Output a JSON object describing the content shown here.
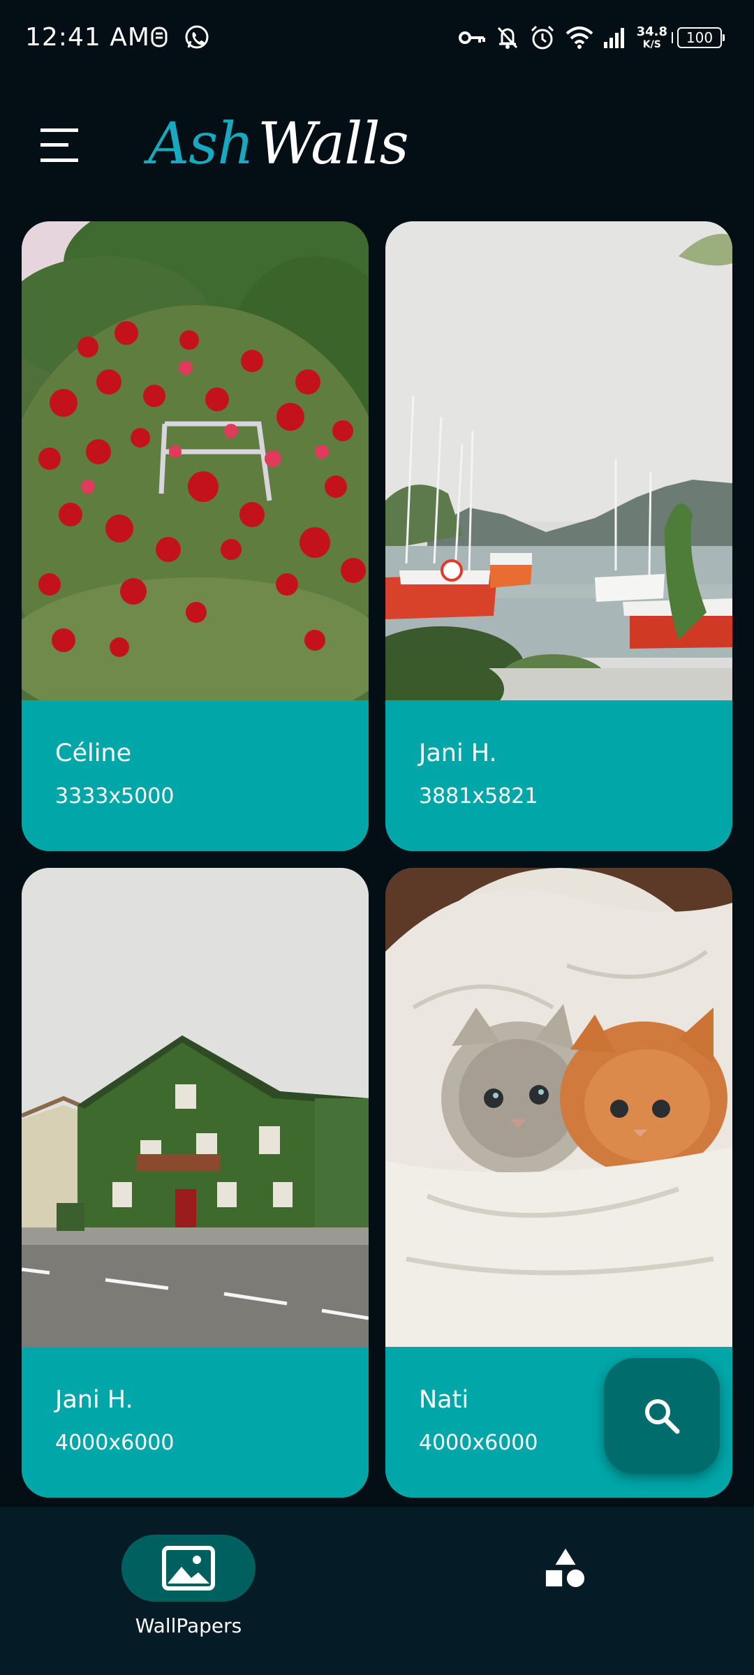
{
  "status_bar": {
    "time": "12:41 AM",
    "left_icons": [
      "notification-app-icon",
      "whatsapp-icon"
    ],
    "right_icons": [
      "vpn-key-icon",
      "bell-off-icon",
      "alarm-icon",
      "wifi-icon",
      "signal-icon"
    ],
    "net_speed_value": "34.8",
    "net_speed_unit": "K/S",
    "battery": "100"
  },
  "app_bar": {
    "menu_icon": "hamburger-menu-icon",
    "title_part1": "Ash",
    "title_part2": "Walls",
    "title_colors": {
      "part1": "#16a9bf",
      "part2": "#ffffff"
    }
  },
  "wallpapers": [
    {
      "author": "Céline",
      "resolution": "3333x5000",
      "subject": "red roses bush"
    },
    {
      "author": "Jani H.",
      "resolution": "3881x5821",
      "subject": "harbor with sailboats"
    },
    {
      "author": "Jani H.",
      "resolution": "4000x6000",
      "subject": "ivy covered house"
    },
    {
      "author": "Nati",
      "resolution": "4000x6000",
      "subject": "two kittens in blanket"
    }
  ],
  "fab": {
    "icon": "search-icon"
  },
  "bottom_nav": {
    "items": [
      {
        "label": "WallPapers",
        "icon": "image-icon",
        "selected": true
      },
      {
        "label": "",
        "icon": "categories-shapes-icon",
        "selected": false
      }
    ]
  },
  "colors": {
    "background": "#030f14",
    "card": "#00a6a8",
    "accent_dark": "#006c6b",
    "nav_bg": "#051b25"
  }
}
